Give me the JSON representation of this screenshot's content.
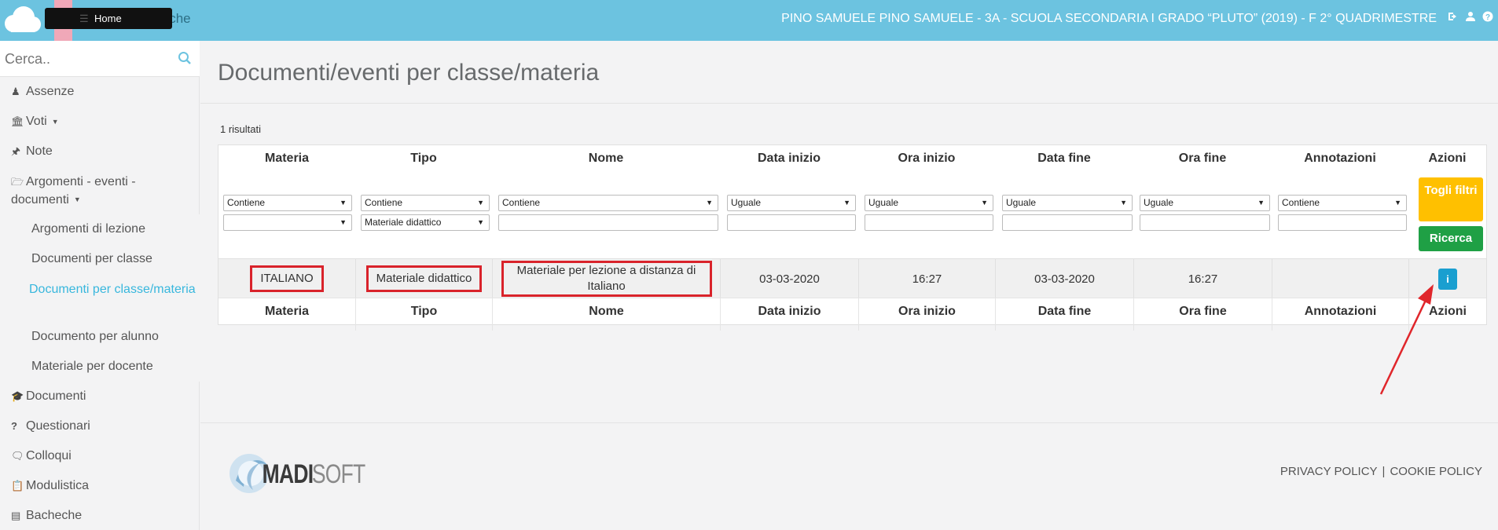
{
  "topbar": {
    "home_label": "Home",
    "bacheche_label": "Bacheche",
    "user_info": "PINO SAMUELE  PINO SAMUELE - 3A - SCUOLA SECONDARIA I GRADO “PLUTO” (2019) - F  2° QUADRIMESTRE",
    "icons": [
      "sign-out-icon",
      "user-icon",
      "help-icon"
    ]
  },
  "sidebar": {
    "search_placeholder": "Cerca..",
    "items": [
      {
        "label": "Assenze",
        "icon": "user-icon"
      },
      {
        "label": "Voti",
        "icon": "bank-icon"
      },
      {
        "label": "Note",
        "icon": "pin-icon"
      },
      {
        "label": "Argomenti - eventi - documenti",
        "icon": "folder-open-icon"
      },
      {
        "label": "Documenti",
        "icon": "graduation-cap-icon"
      },
      {
        "label": "Questionari",
        "icon": "question-icon"
      },
      {
        "label": "Colloqui",
        "icon": "comments-icon"
      },
      {
        "label": "Modulistica",
        "icon": "clipboard-icon"
      },
      {
        "label": "Bacheche",
        "icon": "list-alt-icon"
      }
    ],
    "subitems": [
      {
        "label": "Argomenti di lezione"
      },
      {
        "label": "Documenti per classe"
      },
      {
        "label": "Documenti per classe/materia"
      },
      {
        "label": "Documento per alunno"
      },
      {
        "label": "Materiale per docente"
      }
    ]
  },
  "main": {
    "title": "Documenti/eventi per classe/materia",
    "results": "1 risultati",
    "columns": [
      "Materia",
      "Tipo",
      "Nome",
      "Data inizio",
      "Ora inizio",
      "Data fine",
      "Ora fine",
      "Annotazioni",
      "Azioni"
    ],
    "filters": {
      "ops": [
        "Contiene",
        "Contiene",
        "Contiene",
        "Uguale",
        "Uguale",
        "Uguale",
        "Uguale",
        "Contiene"
      ],
      "materia_value": "",
      "tipo_value": "Materiale didattico"
    },
    "buttons": {
      "togli_filtri": "Togli filtri",
      "ricerca": "Ricerca",
      "info": "i"
    },
    "row": {
      "materia": "ITALIANO",
      "tipo": "Materiale didattico",
      "nome": "Materiale per lezione a distanza di Italiano",
      "data_inizio": "03-03-2020",
      "ora_inizio": "16:27",
      "data_fine": "03-03-2020",
      "ora_fine": "16:27",
      "annotazioni": ""
    }
  },
  "footer": {
    "brand": "MADISOFT",
    "privacy": "PRIVACY POLICY",
    "cookie": "COOKIE POLICY",
    "separator": "|"
  },
  "colors": {
    "topbar": "#6cc3e0",
    "active_link": "#38b7dd",
    "togli_filtri": "#ffc000",
    "ricerca": "#1fa045",
    "info_button": "#1a9fd0",
    "highlight": "#d9232b"
  }
}
